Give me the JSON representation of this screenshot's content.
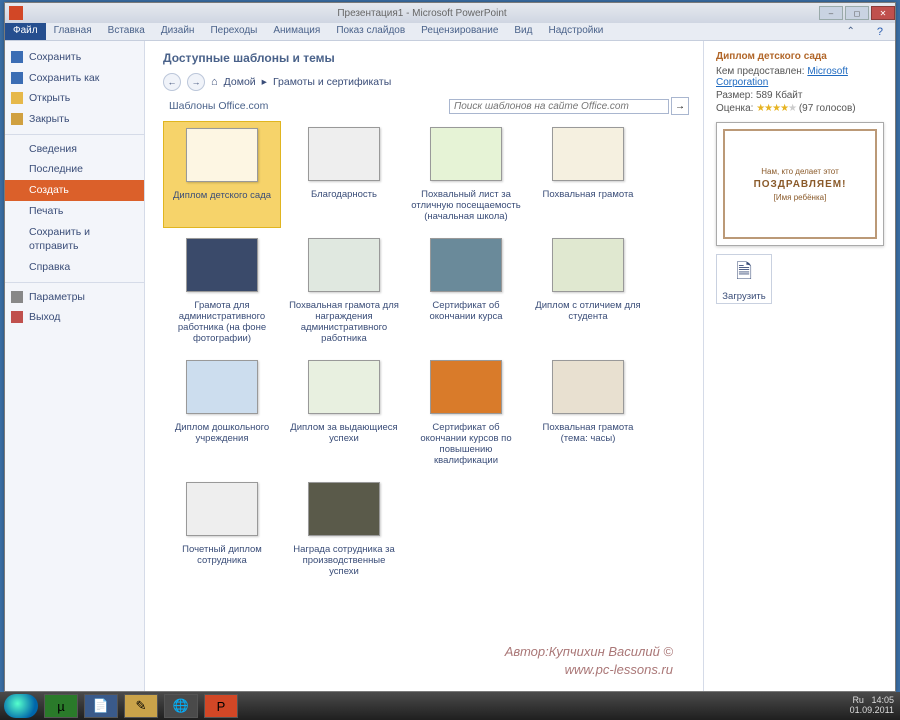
{
  "title": {
    "doc": "Презентация1 - Microsoft PowerPoint"
  },
  "ribbon": {
    "file": "Файл",
    "tabs": [
      "Главная",
      "Вставка",
      "Дизайн",
      "Переходы",
      "Анимация",
      "Показ слайдов",
      "Рецензирование",
      "Вид",
      "Надстройки"
    ]
  },
  "sidebar": {
    "save": "Сохранить",
    "saveas": "Сохранить как",
    "open": "Открыть",
    "close": "Закрыть",
    "info": "Сведения",
    "recent": "Последние",
    "new": "Создать",
    "print": "Печать",
    "share": "Сохранить и отправить",
    "help": "Справка",
    "options": "Параметры",
    "exit": "Выход"
  },
  "central": {
    "heading": "Доступные шаблоны и темы",
    "home": "Домой",
    "crumb": "Грамоты и сертификаты",
    "section": "Шаблоны Office.com",
    "searchPlaceholder": "Поиск шаблонов на сайте Office.com"
  },
  "templates": [
    {
      "label": "Диплом детского сада",
      "sel": true
    },
    {
      "label": "Благодарность"
    },
    {
      "label": "Похвальный лист за отличную посещаемость (начальная школа)"
    },
    {
      "label": "Похвальная грамота"
    },
    {
      "label": "Грамота для административного работника (на фоне фотографии)"
    },
    {
      "label": "Похвальная грамота для награждения административного работника"
    },
    {
      "label": "Сертификат об окончании курса"
    },
    {
      "label": "Диплом с отличием для студента"
    },
    {
      "label": "Диплом дошкольного учреждения"
    },
    {
      "label": "Диплом за выдающиеся успехи"
    },
    {
      "label": "Сертификат об окончании курсов по повышению квалификации"
    },
    {
      "label": "Похвальная грамота (тема: часы)"
    },
    {
      "label": "Почетный диплом сотрудника"
    },
    {
      "label": "Награда сотрудника за производственные успехи"
    }
  ],
  "detail": {
    "title": "Диплом детского сада",
    "providedby_lbl": "Кем предоставлен:",
    "providedby": "Microsoft Corporation",
    "size_lbl": "Размер:",
    "size": "589 Кбайт",
    "rating_lbl": "Оценка:",
    "votes": "(97 голосов)",
    "download": "Загрузить",
    "preview_up": "Нам, кто делает этот",
    "preview_main": "ПОЗДРАВЛЯЕМ!",
    "preview_sub": "[Имя ребёнка]"
  },
  "attribution": {
    "author": "Автор:Купчихин Василий ©",
    "site": "www.pc-lessons.ru"
  },
  "tray": {
    "lang": "Ru",
    "time": "14:05",
    "date": "01.09.2011"
  }
}
